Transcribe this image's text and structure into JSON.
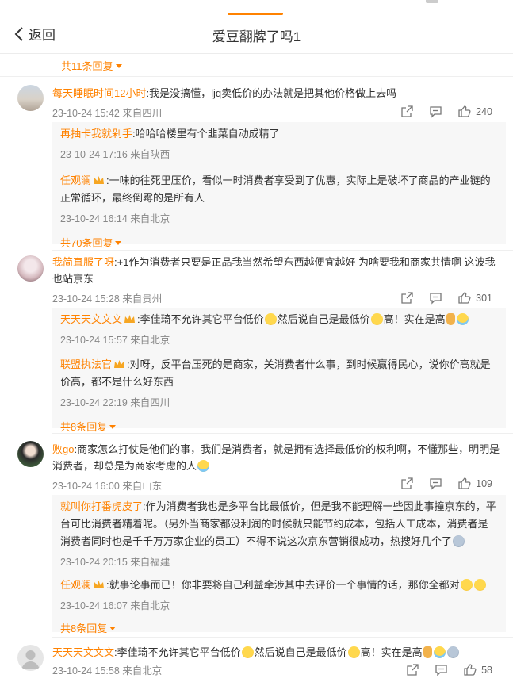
{
  "header": {
    "back_label": "返回",
    "title": "爱豆翻牌了吗1"
  },
  "top_more": "共11条回复",
  "comments": [
    {
      "user": "每天睡眠时间12小时",
      "text": ":我是没搞懂，ljq卖低价的办法就是把其他价格做上去吗",
      "meta": "23-10-24 15:42 来自四川",
      "likes": "240",
      "replies": [
        {
          "user": "再抽卡我就剁手",
          "text": ":哈哈哈楼里有个韭菜自动成精了",
          "meta": "23-10-24 17:16 来自陕西"
        },
        {
          "user": "任观澜",
          "text": ":一味的往死里压价，看似一时消费者享受到了优惠，实际上是破坏了商品的产业链的正常循环，最终倒霉的是所有人",
          "meta": "23-10-24 16:14 来自北京"
        }
      ],
      "more": "共70条回复"
    },
    {
      "user": "我简直服了呀",
      "text": ":+1作为消费者只要是正品我当然希望东西越便宜越好 为啥要我和商家共情啊 这波我也站京东",
      "meta": "23-10-24 15:28 来自贵州",
      "likes": "301",
      "replies": [
        {
          "user": "天天天文文文",
          "text_a": ":李佳琦不允许其它平台低价",
          "text_b": "然后说自己是最低价",
          "text_c": "高！实在是高",
          "meta": "23-10-24 15:57 来自北京"
        },
        {
          "user": "联盟执法官",
          "text": ":对呀，反平台压死的是商家，关消费者什么事，到时候赢得民心，说你价高就是价高，都不是什么好东西",
          "meta": "23-10-24 22:19 来自四川"
        }
      ],
      "more": "共8条回复"
    },
    {
      "user": "败go",
      "text": ":商家怎么打仗是他们的事，我们是消费者，就是拥有选择最低价的权利啊，不懂那些，明明是消费者，却总是为商家考虑的人",
      "meta": "23-10-24 16:00 来自山东",
      "likes": "109",
      "replies": [
        {
          "user": "就叫你打番虎皮了",
          "text": ":作为消费者我也是多平台比最低价，但是我不能理解一些因此事撞京东的，平台可比消费者精着呢。（另外当商家都没利润的时候就只能节约成本，包括人工成本，消费者是消费者同时也是千千万万家企业的员工）不得不说这次京东营销很成功，热搜好几个了",
          "meta": "23-10-24 20:15 来自福建"
        },
        {
          "user": "任观澜",
          "text": ":就事论事而已！你非要将自己利益牵涉其中去评价一个事情的话，那你全都对",
          "meta": "23-10-24 16:07 来自北京"
        }
      ],
      "more": "共8条回复"
    },
    {
      "user": "天天天文文文",
      "text_a": ":李佳琦不允许其它平台低价",
      "text_b": "然后说自己是最低价",
      "text_c": "高！实在是高",
      "meta": "23-10-24 15:58 来自北京",
      "likes": "58"
    }
  ],
  "icons": [
    "chevron-left-icon",
    "share-icon",
    "comment-icon",
    "like-icon",
    "crown-icon"
  ],
  "colors": {
    "accent": "#ff8200",
    "meta": "#888888",
    "reply_bg": "#f7f7f7"
  }
}
